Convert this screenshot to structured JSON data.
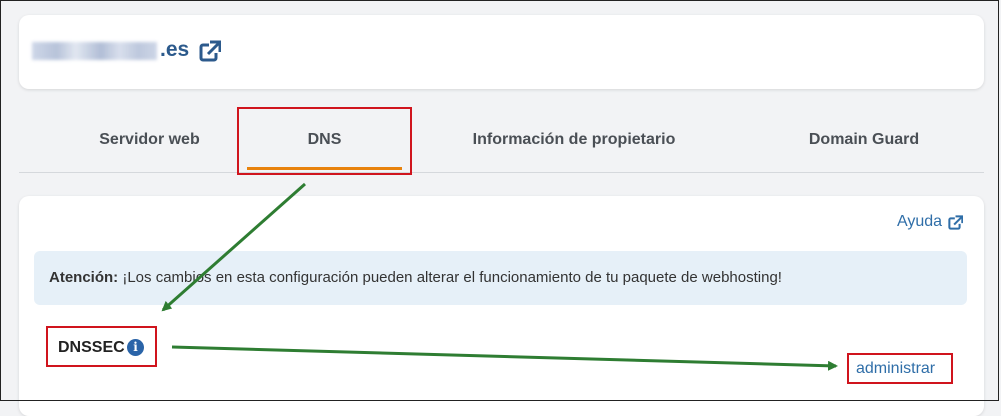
{
  "domain": {
    "suffix": ".es"
  },
  "tabs": [
    {
      "label": "Servidor web"
    },
    {
      "label": "DNS",
      "active": true
    },
    {
      "label": "Información de propietario"
    },
    {
      "label": "Domain Guard"
    }
  ],
  "content": {
    "help_link": "Ayuda",
    "alert": {
      "prefix": "Atención:",
      "message": "¡Los cambios en esta configuración pueden alterar el funcionamiento de tu paquete de webhosting!"
    },
    "dnssec_label": "DNSSEC",
    "info_icon_glyph": "i",
    "admin_link": "administrar"
  },
  "colors": {
    "accent_tab": "#e8820c",
    "link": "#2f6ea8",
    "highlight": "#d0141d",
    "arrow": "#2e7d32"
  },
  "icons": [
    "external-link-icon",
    "info-icon"
  ]
}
